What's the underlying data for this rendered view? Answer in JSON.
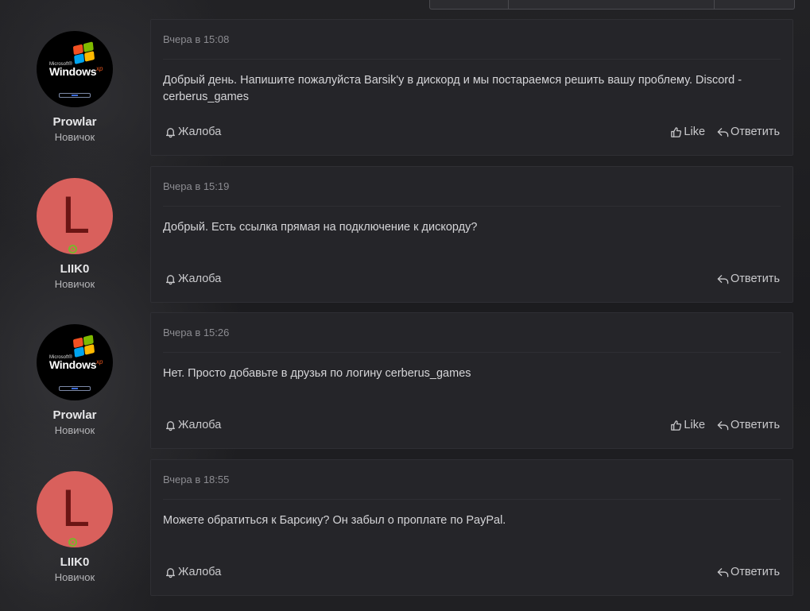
{
  "posts": [
    {
      "author": {
        "name": "Prowlar",
        "rank": "Новичок",
        "avatar": "windows-xp-logo",
        "online": false
      },
      "date": "Вчера в 15:08",
      "text": "Добрый день. Напишите пожалуйста Barsik'у в дискорд и мы постараемся решить вашу проблему. Discord - cerberus_games",
      "report_label": "Жалоба",
      "like_label": "Like",
      "reply_label": "Ответить",
      "has_like": true
    },
    {
      "author": {
        "name": "LIIK0",
        "rank": "Новичок",
        "avatar_letter": "L",
        "online": true
      },
      "date": "Вчера в 15:19",
      "text": "Добрый. Есть ссылка прямая на подключение к дискорду?",
      "report_label": "Жалоба",
      "reply_label": "Ответить",
      "has_like": false
    },
    {
      "author": {
        "name": "Prowlar",
        "rank": "Новичок",
        "avatar": "windows-xp-logo",
        "online": false
      },
      "date": "Вчера в 15:26",
      "text": "Нет. Просто добавьте в друзья по логину cerberus_games",
      "report_label": "Жалоба",
      "like_label": "Like",
      "reply_label": "Ответить",
      "has_like": true
    },
    {
      "author": {
        "name": "LIIK0",
        "rank": "Новичок",
        "avatar_letter": "L",
        "online": true
      },
      "date": "Вчера в 18:55",
      "text": "Можете обратиться к Барсику? Он забыл о проплате по PayPal.",
      "report_label": "Жалоба",
      "reply_label": "Ответить",
      "has_like": false
    }
  ],
  "xp_logo": {
    "small": "Microsoft®",
    "word": "Windows",
    "sup": "xp"
  },
  "colors": {
    "background": "#1b1b1e",
    "card": "#252529",
    "avatar_letter_bg": "#d9605c",
    "online_indicator": "#7bb42c"
  },
  "icons": {
    "report": "bell-icon",
    "like": "thumbs-up-icon",
    "reply": "reply-arrow-icon"
  }
}
